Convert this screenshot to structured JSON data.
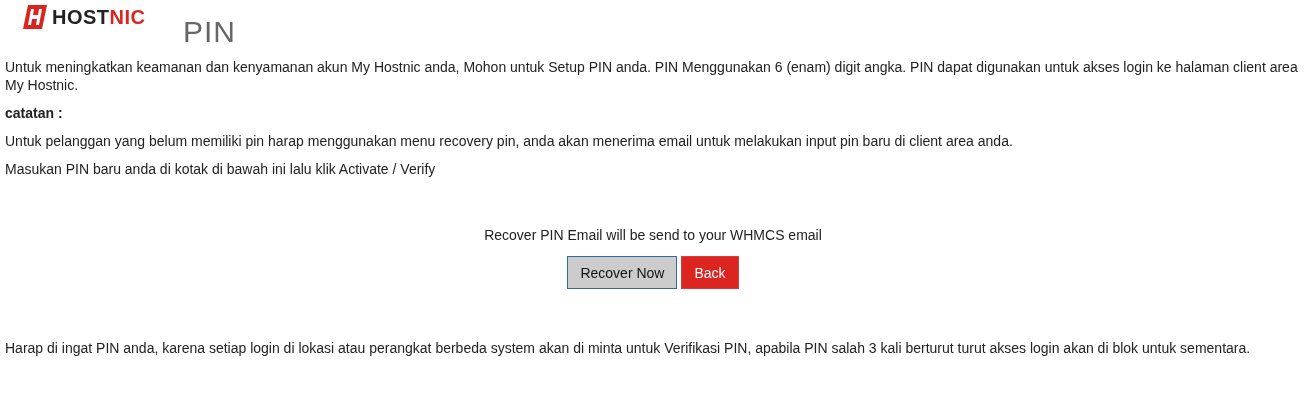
{
  "logo": {
    "text_main": "HOST",
    "text_accent": "NIC"
  },
  "heading": "PIN",
  "intro": "Untuk meningkatkan keamanan dan kenyamanan akun My Hostnic anda, Mohon untuk Setup PIN anda. PIN Menggunakan 6 (enam) digit angka. PIN dapat digunakan untuk akses login ke halaman client area My Hostnic.",
  "note_label": "catatan :",
  "note": "Untuk pelanggan yang belum memiliki pin harap menggunakan menu recovery pin, anda akan menerima email untuk melakukan input pin baru di client area anda.",
  "instruction": "Masukan PIN baru anda di kotak di bawah ini lalu klik Activate / Verify",
  "recover_message": "Recover PIN Email will be send to your WHMCS email",
  "buttons": [
    {
      "kind": "default",
      "label": "Recover Now"
    },
    {
      "kind": "danger",
      "label": "Back"
    }
  ],
  "footer_note": "Harap di ingat PIN anda, karena setiap login di lokasi atau perangkat berbeda system akan di minta untuk Verifikasi PIN, apabila PIN salah 3 kali berturut turut akses login akan di blok untuk sementara."
}
